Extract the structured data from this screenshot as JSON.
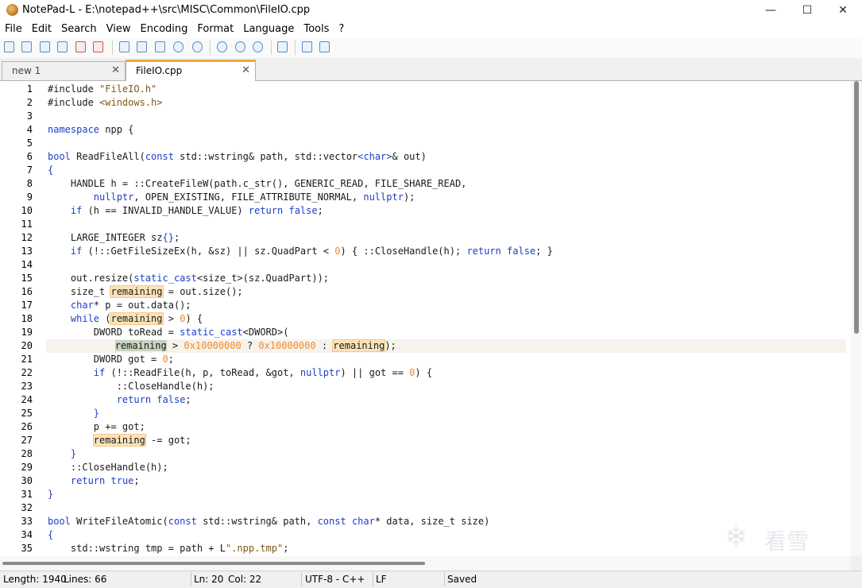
{
  "window": {
    "title": "NotePad-L - E:\\notepad++\\src\\MISC\\Common\\FileIO.cpp"
  },
  "menu": [
    "File",
    "Edit",
    "Search",
    "View",
    "Encoding",
    "Format",
    "Language",
    "Tools",
    "?"
  ],
  "tabs": [
    {
      "label": "new 1",
      "active": false
    },
    {
      "label": "FileIO.cpp",
      "active": true
    }
  ],
  "editor": {
    "current_line": 20,
    "lines": [
      {
        "n": "1",
        "html": "#include <span class='str'>\"FileIO.h\"</span>"
      },
      {
        "n": "2",
        "html": "#include <span class='str'>&lt;windows.h&gt;</span>"
      },
      {
        "n": "3",
        "html": ""
      },
      {
        "n": "4",
        "html": "<span class='kw'>namespace</span> npp {"
      },
      {
        "n": "5",
        "html": ""
      },
      {
        "n": "6",
        "html": "<span class='kw'>bool</span> ReadFileAll(<span class='kw'>const</span> std::wstring&amp; path, std::vector<span class='kw'>&lt;char&gt;</span>&amp; out)"
      },
      {
        "n": "7",
        "html": "<span class='kw'>{</span>"
      },
      {
        "n": "8",
        "html": "    HANDLE h = ::CreateFileW(path.c_str(), GENERIC_READ, FILE_SHARE_READ,"
      },
      {
        "n": "9",
        "html": "        <span class='kw'>nullptr</span>, OPEN_EXISTING, FILE_ATTRIBUTE_NORMAL, <span class='kw'>nullptr</span>);"
      },
      {
        "n": "10",
        "html": "    <span class='kw'>if</span> (h == INVALID_HANDLE_VALUE) <span class='kw'>return</span> <span class='kw'>false</span>;"
      },
      {
        "n": "11",
        "html": ""
      },
      {
        "n": "12",
        "html": "    LARGE_INTEGER sz<span class='kw'>{}</span>;"
      },
      {
        "n": "13",
        "html": "    <span class='kw'>if</span> (!::GetFileSizeEx(h, &amp;sz) || sz.QuadPart &lt; <span class='num'>0</span>) { ::CloseHandle(h); <span class='kw'>return</span> <span class='kw'>false</span>; }"
      },
      {
        "n": "14",
        "html": ""
      },
      {
        "n": "15",
        "html": "    out.resize(<span class='kw'>static_cast</span>&lt;size_t&gt;(sz.QuadPart));"
      },
      {
        "n": "16",
        "html": "    size_t <span class='hl'>remaining</span> = out.size();"
      },
      {
        "n": "17",
        "html": "    <span class='kw'>char</span>* p = out.data();"
      },
      {
        "n": "18",
        "html": "    <span class='kw'>while</span> (<span class='hl'>remaining</span> &gt; <span class='num'>0</span>) {"
      },
      {
        "n": "19",
        "html": "        DWORD toRead = <span class='kw'>static_cast</span>&lt;DWORD&gt;("
      },
      {
        "n": "20",
        "html": "            <span class='sel'>remaining</span> &gt; <span class='num'>0x10000000</span> ? <span class='num'>0x10000000</span> : <span class='hl'>remaining</span>);"
      },
      {
        "n": "21",
        "html": "        DWORD got = <span class='num'>0</span>;"
      },
      {
        "n": "22",
        "html": "        <span class='kw'>if</span> (!::ReadFile(h, p, toRead, &amp;got, <span class='kw'>nullptr</span>) || got == <span class='num'>0</span>) {"
      },
      {
        "n": "23",
        "html": "            ::CloseHandle(h);"
      },
      {
        "n": "24",
        "html": "            <span class='kw'>return</span> <span class='kw'>false</span>;"
      },
      {
        "n": "25",
        "html": "        <span class='kw'>}</span>"
      },
      {
        "n": "26",
        "html": "        p += got;"
      },
      {
        "n": "27",
        "html": "        <span class='hl'>remaining</span> -= got;"
      },
      {
        "n": "28",
        "html": "    <span class='kw'>}</span>"
      },
      {
        "n": "29",
        "html": "    ::CloseHandle(h);"
      },
      {
        "n": "30",
        "html": "    <span class='kw'>return</span> <span class='kw'>true</span>;"
      },
      {
        "n": "31",
        "html": "<span class='kw'>}</span>"
      },
      {
        "n": "32",
        "html": ""
      },
      {
        "n": "33",
        "html": "<span class='kw'>bool</span> WriteFileAtomic(<span class='kw'>const</span> std::wstring&amp; path, <span class='kw'>const</span> <span class='kw'>char</span>* data, size_t size)"
      },
      {
        "n": "34",
        "html": "<span class='kw'>{</span>"
      },
      {
        "n": "35",
        "html": "    std::wstring tmp = path + L<span class='str'>\".npp.tmp\"</span>;"
      }
    ]
  },
  "status": {
    "length": "Length: 1940",
    "lines": "Lines: 66",
    "ln": "Ln: 20",
    "col": "Col: 22",
    "encoding": "UTF-8 - C++",
    "eol": "LF",
    "saved": "Saved"
  },
  "watermark": {
    "text": "看雪",
    "icon": "snowflake-icon"
  }
}
